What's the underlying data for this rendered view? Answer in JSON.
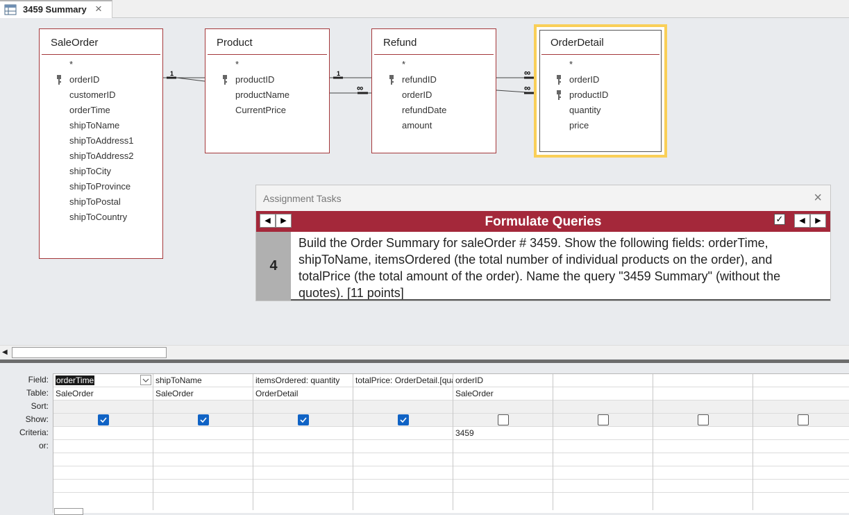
{
  "tab": {
    "title": "3459 Summary"
  },
  "tables": [
    {
      "name": "SaleOrder",
      "fields": [
        "*",
        "orderID",
        "customerID",
        "orderTime",
        "shipToName",
        "shipToAddress1",
        "shipToAddress2",
        "shipToCity",
        "shipToProvince",
        "shipToPostal",
        "shipToCountry"
      ]
    },
    {
      "name": "Product",
      "fields": [
        "*",
        "productID",
        "productName",
        "CurrentPrice"
      ]
    },
    {
      "name": "Refund",
      "fields": [
        "*",
        "refundID",
        "orderID",
        "refundDate",
        "amount"
      ]
    },
    {
      "name": "OrderDetail",
      "fields": [
        "*",
        "orderID",
        "productID",
        "quantity",
        "price"
      ]
    }
  ],
  "relationships": {
    "one": "1",
    "many": "∞"
  },
  "tasks": {
    "panel_title": "Assignment Tasks",
    "section_title": "Formulate Queries",
    "task_number": "4",
    "task_text": "Build the Order Summary for saleOrder # 3459.  Show the following fields: orderTime, shipToName, itemsOrdered (the total number of individual products on the order), and totalPrice (the total amount of the order).  Name the query \"3459 Summary\" (without the quotes). [11 points]",
    "checked": "✓"
  },
  "grid": {
    "row_labels": [
      "Field:",
      "Table:",
      "Sort:",
      "Show:",
      "Criteria:",
      "or:"
    ],
    "columns": [
      {
        "field": "orderTime",
        "table": "SaleOrder",
        "show": true,
        "criteria": ""
      },
      {
        "field": "shipToName",
        "table": "SaleOrder",
        "show": true,
        "criteria": ""
      },
      {
        "field": "itemsOrdered: quantity",
        "table": "OrderDetail",
        "show": true,
        "criteria": ""
      },
      {
        "field": "totalPrice: OrderDetail.[quantity]*[price]",
        "table": "",
        "show": true,
        "criteria": ""
      },
      {
        "field": "orderID",
        "table": "SaleOrder",
        "show": false,
        "criteria": "3459"
      },
      {
        "field": "",
        "table": "",
        "show": false,
        "criteria": ""
      },
      {
        "field": "",
        "table": "",
        "show": false,
        "criteria": ""
      },
      {
        "field": "",
        "table": "",
        "show": false,
        "criteria": ""
      }
    ]
  },
  "icons": {
    "tab": "query-design-icon",
    "close": "close-icon",
    "key": "primary-key-icon"
  }
}
